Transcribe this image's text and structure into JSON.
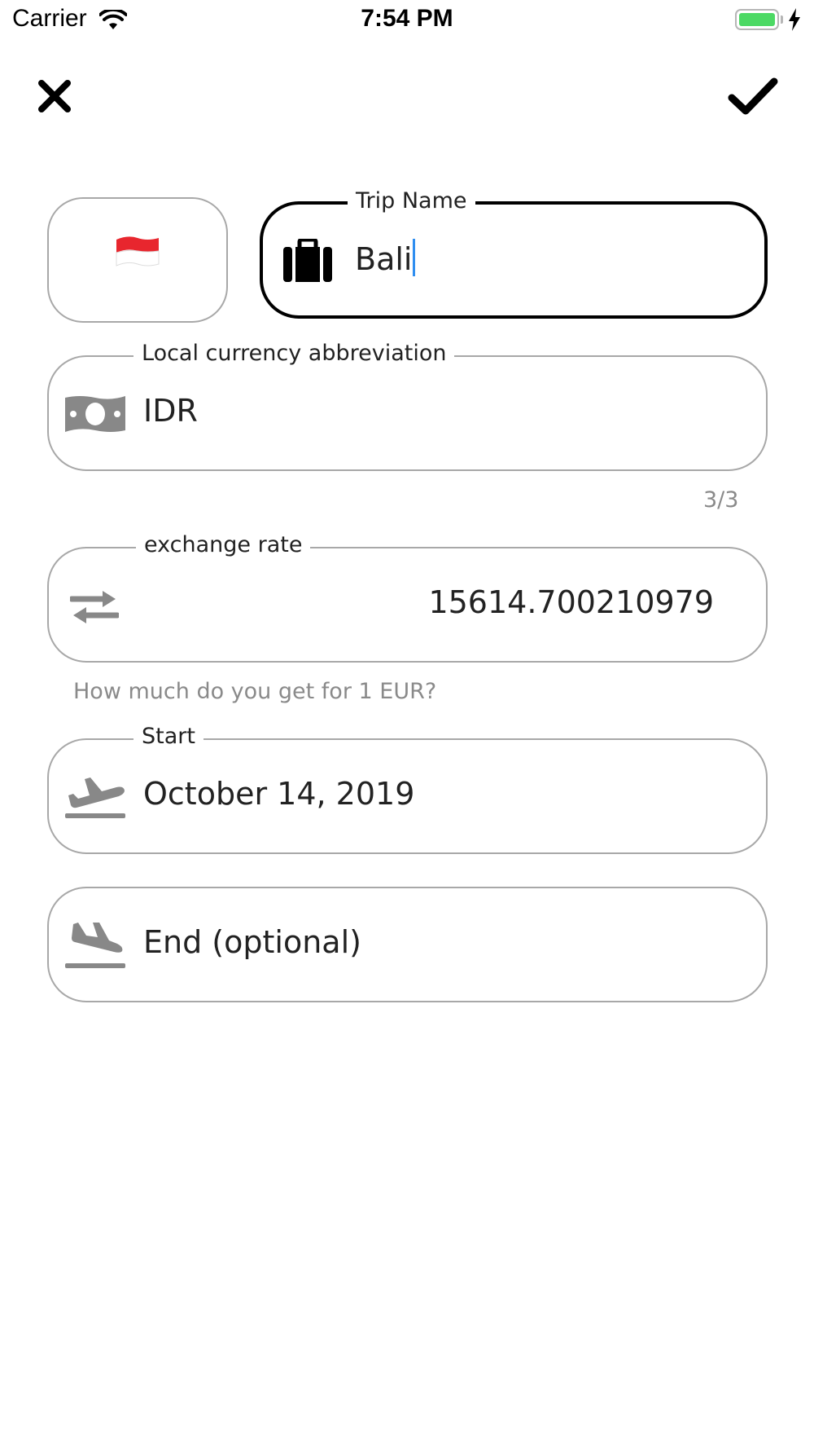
{
  "status_bar": {
    "carrier": "Carrier",
    "time": "7:54 PM"
  },
  "nav": {
    "close_icon": "close-icon",
    "confirm_icon": "checkmark-icon"
  },
  "flag": {
    "emoji": "🇮🇩"
  },
  "trip_name": {
    "label": "Trip Name",
    "value": "Bali",
    "icon": "suitcase-icon"
  },
  "currency": {
    "label": "Local currency abbreviation",
    "value": "IDR",
    "counter": "3/3",
    "icon": "money-icon"
  },
  "exchange": {
    "label": "exchange rate",
    "value": "15614.700210979",
    "helper": "How much do you get for 1 EUR?",
    "icon": "exchange-icon"
  },
  "start": {
    "label": "Start",
    "value": "October 14, 2019",
    "icon": "plane-departure-icon"
  },
  "end": {
    "placeholder": "End (optional)",
    "icon": "plane-arrival-icon"
  },
  "colors": {
    "focus_border": "#000000",
    "idle_border": "#a8a8a8",
    "icon_gray": "#888888",
    "caret": "#2f8ef0",
    "battery": "#4cd964"
  }
}
